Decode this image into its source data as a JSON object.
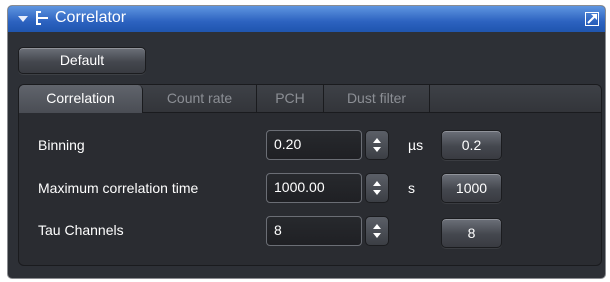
{
  "panel": {
    "title": "Correlator",
    "colors": {
      "titlebar": "#2c62c0",
      "panel_bg": "#2d3036",
      "text": "#ffffff",
      "inactive_tab_text": "#8c8f95"
    }
  },
  "toolbar": {
    "default_label": "Default"
  },
  "tabs": [
    {
      "label": "Correlation",
      "active": true
    },
    {
      "label": "Count rate",
      "active": false
    },
    {
      "label": "PCH",
      "active": false
    },
    {
      "label": "Dust filter",
      "active": false
    }
  ],
  "rows": [
    {
      "label": "Binning",
      "value": "0.20",
      "unit": "µs",
      "preset": "0.2"
    },
    {
      "label": "Maximum correlation time",
      "value": "1000.00",
      "unit": "s",
      "preset": "1000"
    },
    {
      "label": "Tau Channels",
      "value": "8",
      "unit": "",
      "preset": "8"
    }
  ],
  "icons": {
    "collapse": "triangle-down-icon",
    "tree": "tree-branch-icon",
    "undock": "undock-arrow-icon",
    "spin": "spin-up-down-icon"
  }
}
